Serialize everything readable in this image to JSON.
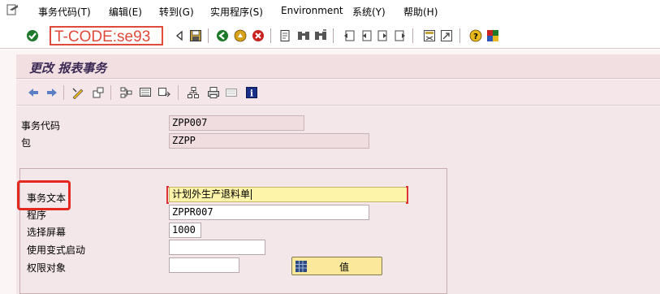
{
  "menu": {
    "items": [
      {
        "label": "事务代码(T)"
      },
      {
        "label": "编辑(E)"
      },
      {
        "label": "转到(G)"
      },
      {
        "label": "实用程序(S)"
      },
      {
        "label": "Environment"
      },
      {
        "label": "系统(Y)"
      },
      {
        "label": "帮助(H)"
      }
    ]
  },
  "toolbar": {
    "command_field": "T-CODE:se93",
    "icons": [
      "enter-icon",
      "command-history-icon",
      "save-icon",
      "back-icon",
      "exit-icon",
      "cancel-icon",
      "print-icon",
      "find-icon",
      "find-next-icon",
      "first-page-icon",
      "previous-page-icon",
      "next-page-icon",
      "last-page-icon",
      "new-session-icon",
      "shortcut-icon",
      "help-icon",
      "layout-icon"
    ]
  },
  "page": {
    "title": "更改 报表事务"
  },
  "app_toolbar": {
    "icons": [
      "previous-object-icon",
      "next-object-icon",
      "display-change-icon",
      "other-object-icon",
      "where-used-icon",
      "object-list-icon",
      "navigation-window-icon",
      "hierarchy-icon",
      "print-icon",
      "documentation-icon",
      "info-icon"
    ]
  },
  "fields": {
    "transaction_code": {
      "label": "事务代码",
      "value": "ZPP007"
    },
    "package": {
      "label": "包",
      "value": "ZZPP"
    },
    "transaction_text": {
      "label": "事务文本",
      "value": "计划外生产退料单"
    },
    "program": {
      "label": "程序",
      "value": "ZPPR007"
    },
    "selection_screen": {
      "label": "选择屏幕",
      "value": "1000"
    },
    "start_with_variant": {
      "label": "使用变式启动",
      "value": ""
    },
    "authorization_object": {
      "label": "权限对象",
      "value": ""
    }
  },
  "buttons": {
    "values": {
      "label": "值"
    }
  },
  "colors": {
    "annotation_red": "#e3281f",
    "required_yellow": "#fdf3a9",
    "title_bg": "#f2dfe2",
    "form_bg": "#f4e7e9"
  }
}
